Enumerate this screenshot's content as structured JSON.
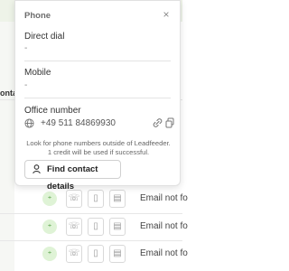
{
  "popup": {
    "title": "Phone",
    "close_symbol": "×",
    "direct_dial": {
      "label": "Direct dial",
      "value": "-"
    },
    "mobile": {
      "label": "Mobile",
      "value": "-"
    },
    "office": {
      "label": "Office number",
      "value": "+49 511 84869930"
    },
    "hint_line1": "Look for phone numbers outside of Leadfeeder.",
    "hint_line2": "1 credit will be used if successful.",
    "find_button": "Find contact details"
  },
  "background": {
    "column_header": "ontac",
    "rows": [
      {
        "email_status": "Email not fo"
      },
      {
        "email_status": "Email not fo"
      },
      {
        "email_status": "Email not fo"
      }
    ]
  },
  "icons": [
    "globe-icon",
    "link-icon",
    "copy-icon",
    "person-search-icon",
    "phone-icon",
    "mobile-icon",
    "contact-card-icon",
    "user-add-icon"
  ],
  "colors": {
    "accent_green": "#4a9a3a",
    "badge_bg": "#dff3d6",
    "topbar_bg": "#eef3e8"
  }
}
